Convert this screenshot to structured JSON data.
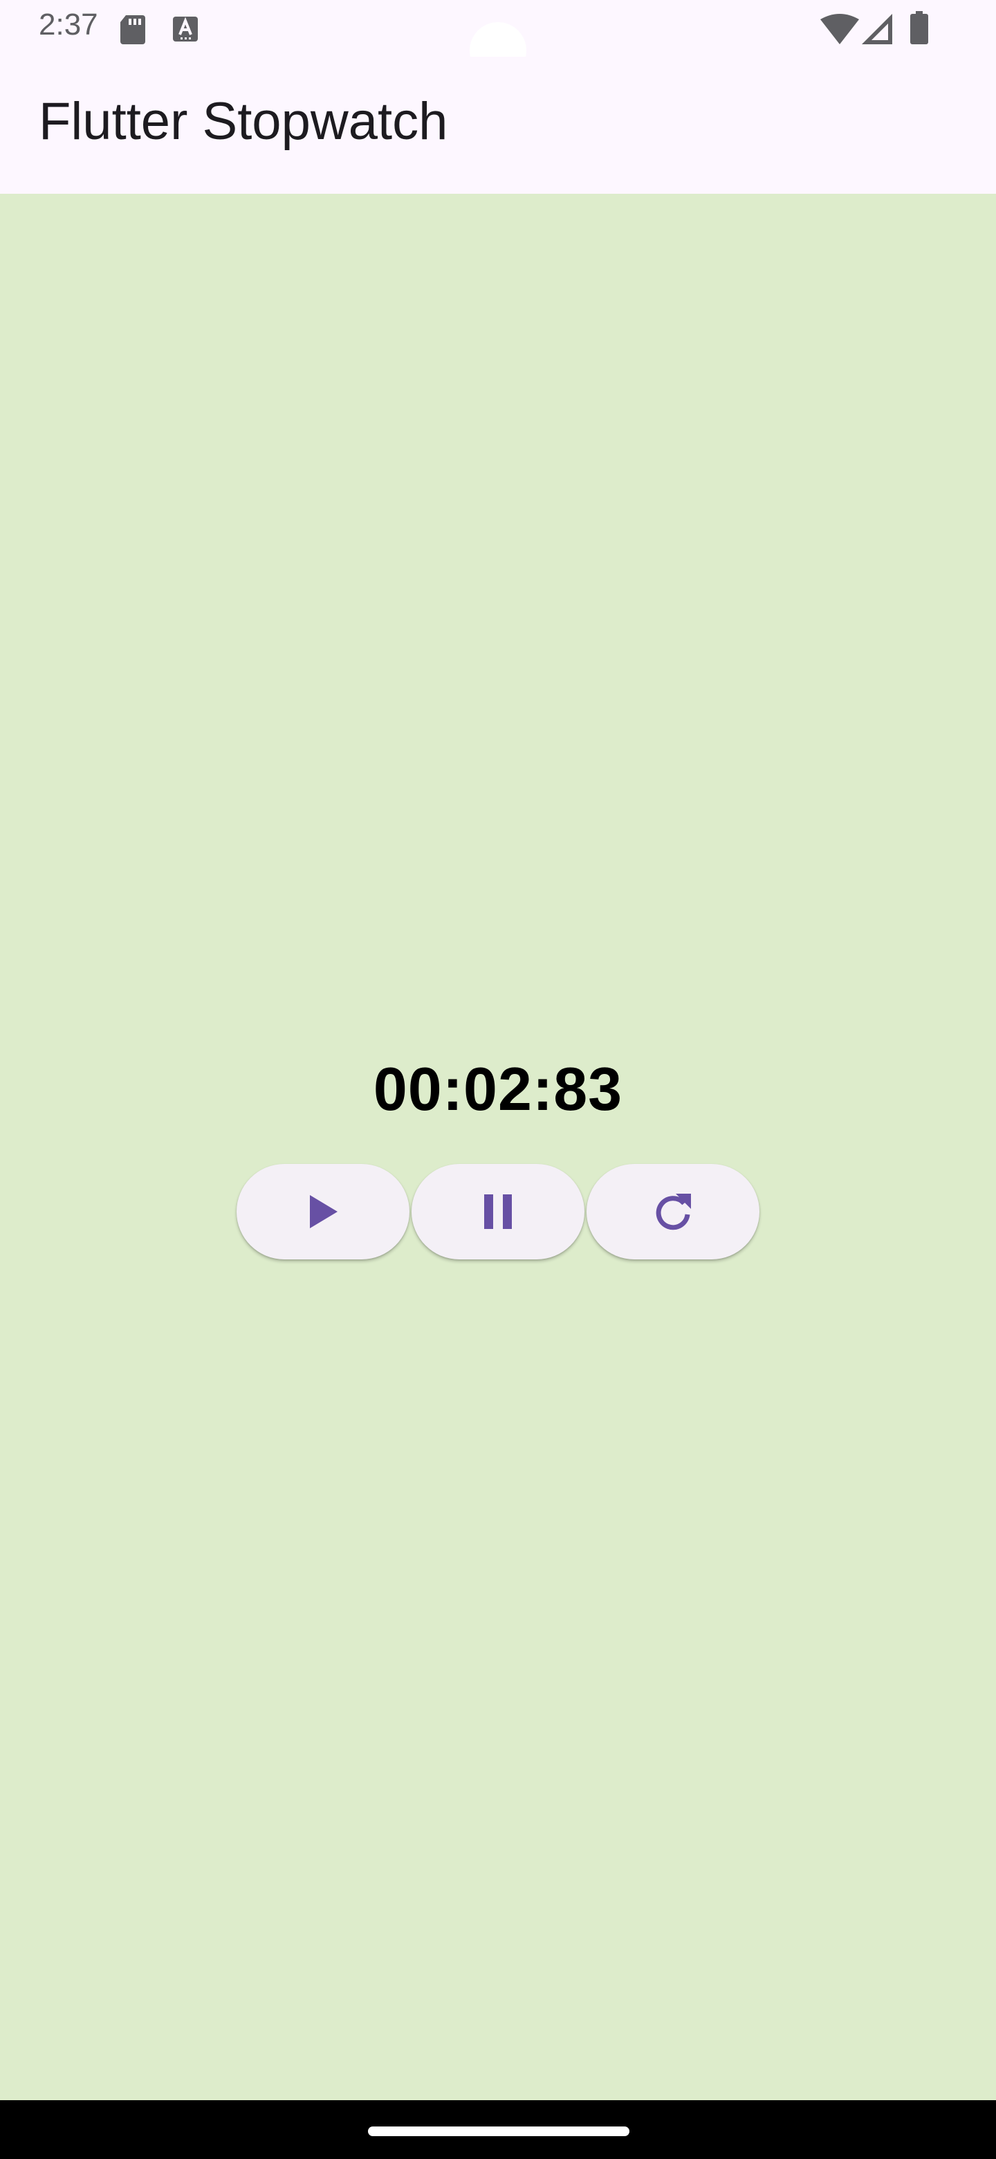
{
  "status_bar": {
    "time": "2:37",
    "icons": [
      "sd-card-icon",
      "keyboard-a-icon",
      "wifi-icon",
      "signal-icon",
      "battery-icon"
    ]
  },
  "app_bar": {
    "title": "Flutter Stopwatch"
  },
  "stopwatch": {
    "elapsed": "00:02:83"
  },
  "controls": [
    {
      "name": "start-button",
      "icon": "play-icon"
    },
    {
      "name": "pause-button",
      "icon": "pause-icon"
    },
    {
      "name": "reset-button",
      "icon": "refresh-icon"
    }
  ],
  "colors": {
    "background": "#ddeccb",
    "app_bar": "#fdf7ff",
    "button_bg": "#f4f0f6",
    "icon_accent": "#6750a4",
    "timer_text": "#000000"
  }
}
